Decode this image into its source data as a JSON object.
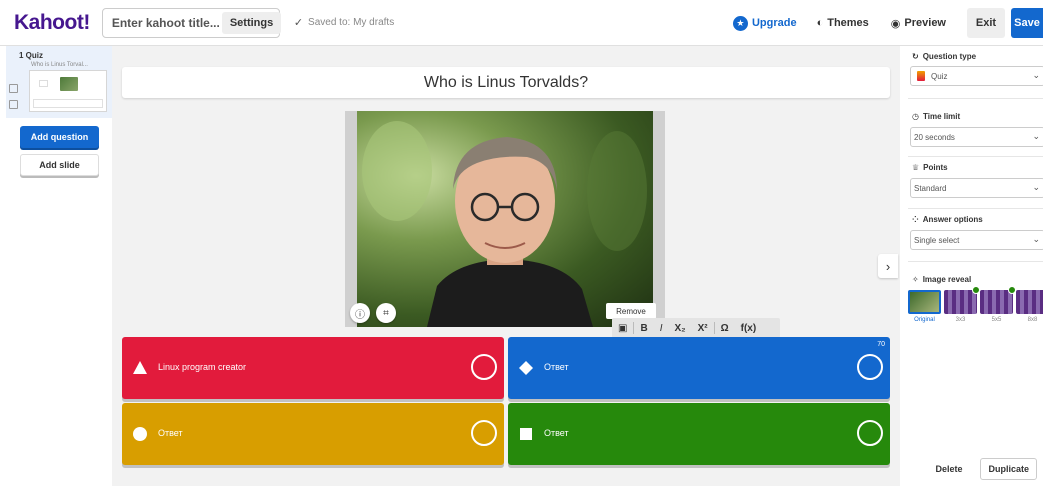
{
  "header": {
    "logo": "Kahoot!",
    "title_placeholder": "Enter kahoot title...",
    "settings_label": "Settings",
    "saved_text": "Saved to: My drafts",
    "upgrade_label": "Upgrade",
    "themes_label": "Themes",
    "preview_label": "Preview",
    "exit_label": "Exit",
    "save_label": "Save"
  },
  "sidebar": {
    "slide": {
      "number": "1 Quiz",
      "title": "Who is Linus Torval..."
    },
    "add_question_label": "Add question",
    "add_slide_label": "Add slide"
  },
  "question": {
    "text": "Who is Linus Torvalds?",
    "remove_label": "Remove"
  },
  "format_toolbar": {
    "bold": "B",
    "italic": "I",
    "subscript": "X₂",
    "superscript": "X²",
    "omega": "Ω",
    "function": "f(x)"
  },
  "answers": [
    {
      "text": "Linux program creator",
      "shape": "triangle",
      "color": "#e21b3c"
    },
    {
      "text": "Ответ",
      "shape": "diamond",
      "color": "#1368ce",
      "char_count": "70"
    },
    {
      "text": "Ответ",
      "shape": "circle",
      "color": "#d89e00"
    },
    {
      "text": "Ответ",
      "shape": "square",
      "color": "#26890c"
    }
  ],
  "right_panel": {
    "question_type_label": "Question type",
    "question_type_value": "Quiz",
    "time_limit_label": "Time limit",
    "time_limit_value": "20 seconds",
    "points_label": "Points",
    "points_value": "Standard",
    "answer_options_label": "Answer options",
    "answer_options_value": "Single select",
    "image_reveal_label": "Image reveal",
    "image_reveal_options": [
      "Original",
      "3x3",
      "5x5",
      "8x8"
    ],
    "delete_label": "Delete",
    "duplicate_label": "Duplicate"
  },
  "icons": {
    "saved": "check-icon",
    "upgrade": "star-icon",
    "themes": "palette-icon",
    "preview": "eye-icon",
    "collapse": "chevron-right-icon"
  }
}
